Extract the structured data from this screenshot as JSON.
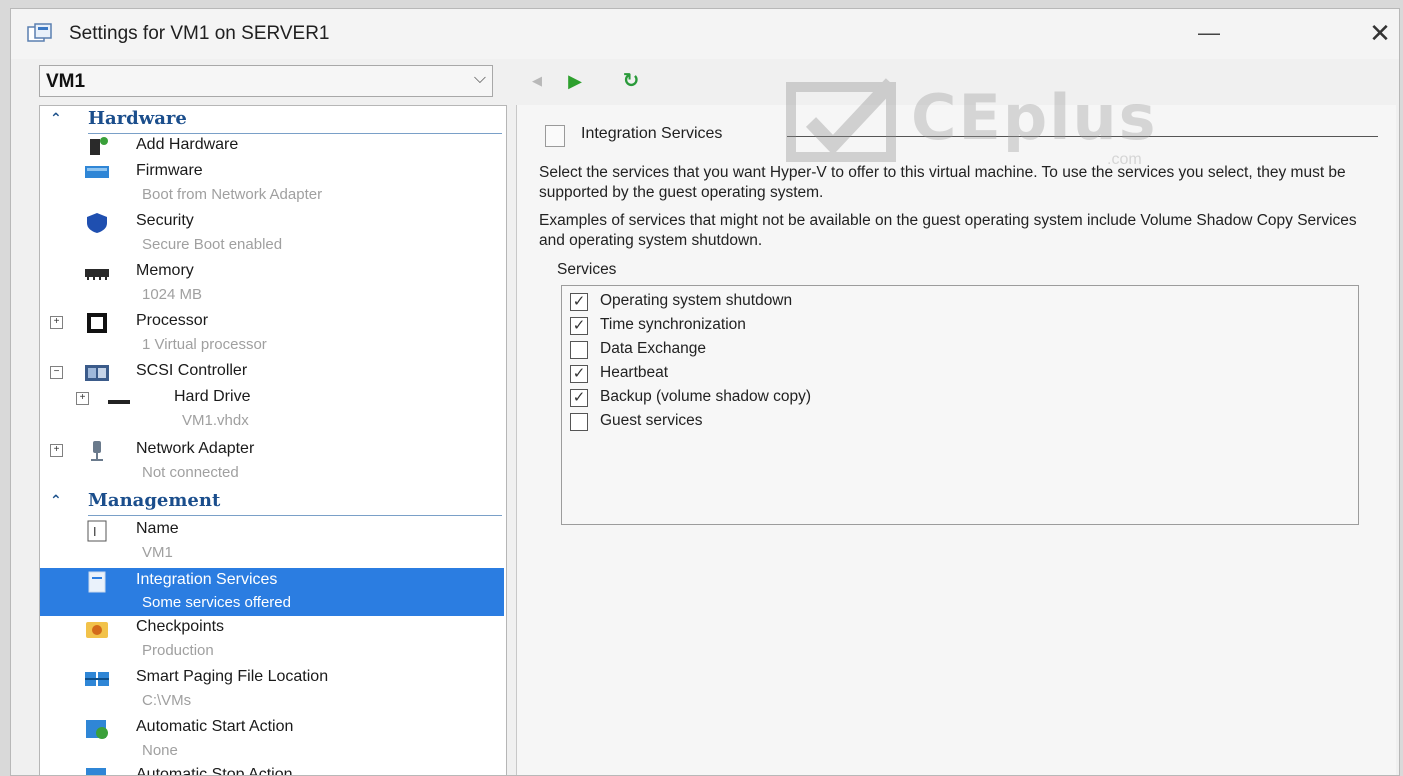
{
  "window": {
    "title": "Settings for VM1 on SERVER1",
    "minimize_glyph": "—",
    "close_glyph": "✕"
  },
  "vm_selector": {
    "value": "VM1",
    "arrow": "⌵"
  },
  "nav": {
    "back": "◀",
    "next": "▶",
    "refresh": "↻"
  },
  "hardware": {
    "label": "Hardware",
    "items": [
      {
        "label": "Add Hardware",
        "sub": "",
        "icon": "add-hardware-icon"
      },
      {
        "label": "Firmware",
        "sub": "Boot from Network Adapter",
        "icon": "firmware-icon"
      },
      {
        "label": "Security",
        "sub": "Secure Boot enabled",
        "icon": "shield-icon"
      },
      {
        "label": "Memory",
        "sub": "1024 MB",
        "icon": "memory-icon"
      },
      {
        "label": "Processor",
        "sub": "1 Virtual processor",
        "icon": "processor-icon",
        "expander": "+"
      },
      {
        "label": "SCSI Controller",
        "sub": "",
        "icon": "scsi-controller-icon",
        "expander": "−"
      },
      {
        "label": "Hard Drive",
        "sub": "VM1.vhdx",
        "icon": "hard-drive-icon",
        "expander": "+"
      },
      {
        "label": "Network Adapter",
        "sub": "Not connected",
        "icon": "network-adapter-icon",
        "expander": "+"
      }
    ]
  },
  "management": {
    "label": "Management",
    "items": [
      {
        "label": "Name",
        "sub": "VM1",
        "icon": "name-icon"
      },
      {
        "label": "Integration Services",
        "sub": "Some services offered",
        "icon": "integration-services-icon",
        "selected": true
      },
      {
        "label": "Checkpoints",
        "sub": "Production",
        "icon": "checkpoints-icon"
      },
      {
        "label": "Smart Paging File Location",
        "sub": "C:\\VMs",
        "icon": "smart-paging-icon"
      },
      {
        "label": "Automatic Start Action",
        "sub": "None",
        "icon": "automatic-start-icon"
      },
      {
        "label": "Automatic Stop Action",
        "sub": "",
        "icon": "automatic-stop-icon"
      }
    ]
  },
  "integration_services": {
    "title": "Integration Services",
    "description1": "Select the services that you want Hyper-V to offer to this virtual machine. To use the services you select, they must be supported by the guest operating system.",
    "description2": "Examples of services that might not be available on the guest operating system include Volume Shadow Copy Services and operating system shutdown.",
    "services_label": "Services",
    "services": [
      {
        "label": "Operating system shutdown",
        "checked": true
      },
      {
        "label": "Time synchronization",
        "checked": true
      },
      {
        "label": "Data Exchange",
        "checked": false
      },
      {
        "label": "Heartbeat",
        "checked": true
      },
      {
        "label": "Backup (volume shadow copy)",
        "checked": true
      },
      {
        "label": "Guest services",
        "checked": false
      }
    ]
  },
  "watermark": {
    "text": "CEplus",
    "sub": ".com"
  },
  "colors": {
    "selection": "#2b7de1",
    "section_header": "#1b4e8c",
    "accent_green": "#2ea02e"
  }
}
